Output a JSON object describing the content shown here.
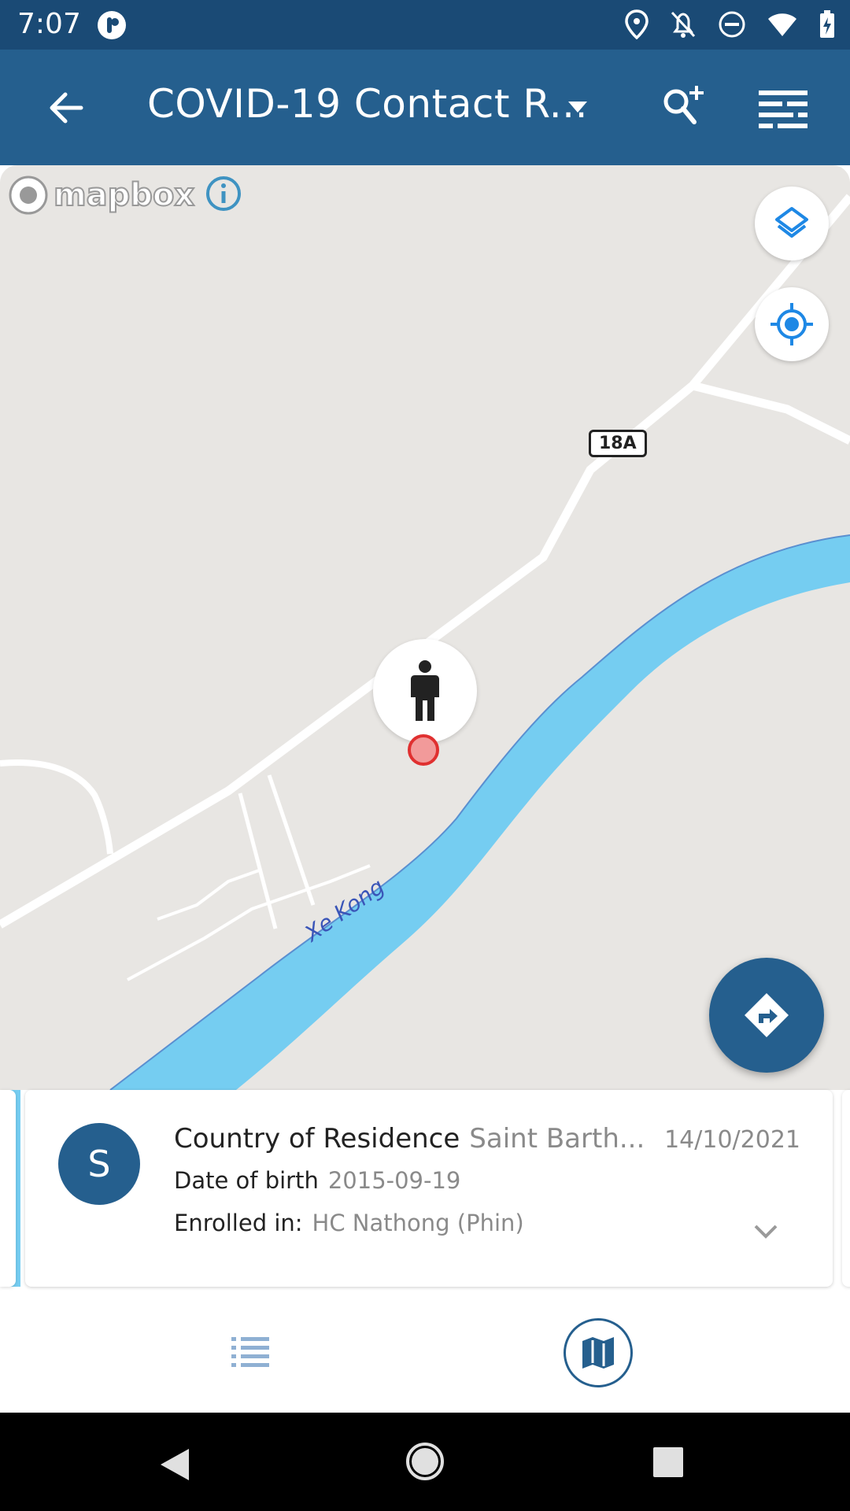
{
  "status_bar": {
    "time": "7:07",
    "icons": [
      "app-notification-icon",
      "location-icon",
      "notifications-off-icon",
      "do-not-disturb-icon",
      "wifi-icon",
      "battery-charging-icon"
    ]
  },
  "app_bar": {
    "title": "COVID-19 Contact R...",
    "icons": [
      "back-arrow-icon",
      "dropdown-icon",
      "search-add-icon",
      "filter-icon"
    ]
  },
  "map": {
    "attribution": "mapbox",
    "road_label": "18A",
    "river_label": "Xe Kong",
    "colors": {
      "land": "#e8e6e3",
      "water": "#75cdf1",
      "road": "#ffffff"
    }
  },
  "card": {
    "avatar_letter": "S",
    "attribute_label": "Country of Residence",
    "attribute_value": "Saint Barth...",
    "date": "14/10/2021",
    "dob_label": "Date of birth",
    "dob_value": "2015-09-19",
    "enrolled_label": "Enrolled in:",
    "enrolled_value": "HC Nathong (Phin)"
  },
  "bottom_nav": {
    "items": [
      "list-view-icon",
      "map-view-icon"
    ],
    "active": "map-view-icon"
  },
  "colors": {
    "primary": "#255f8e",
    "status_bar": "#1a4a75",
    "accent_blue": "#1e88e5"
  }
}
